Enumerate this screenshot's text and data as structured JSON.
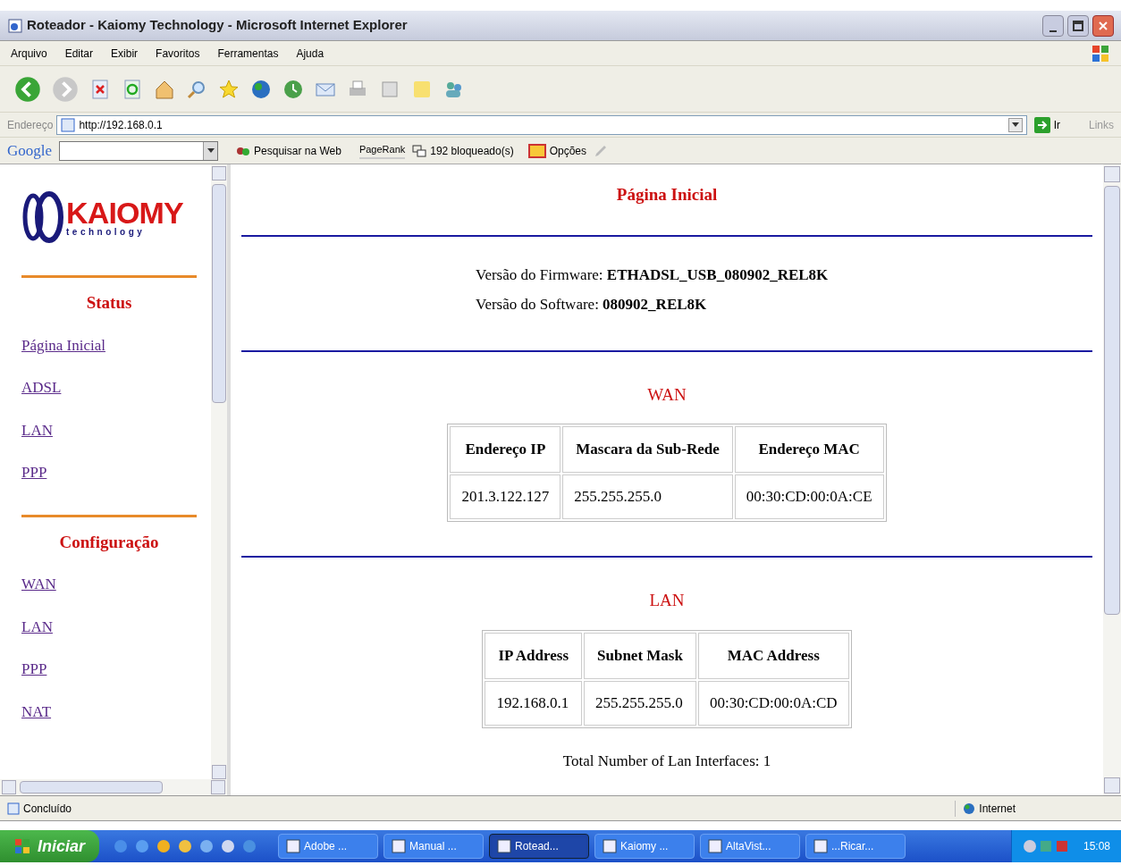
{
  "window": {
    "title": "Roteador - Kaiomy Technology - Microsoft Internet Explorer"
  },
  "menu": [
    "Arquivo",
    "Editar",
    "Exibir",
    "Favoritos",
    "Ferramentas",
    "Ajuda"
  ],
  "address": {
    "label": "Endereço",
    "url": "http://192.168.0.1",
    "go": "Ir",
    "links": "Links"
  },
  "google_bar": {
    "brand": "Google",
    "search_button": "Pesquisar na Web",
    "pagerank": "PageRank",
    "blocked": "192 bloqueado(s)",
    "options": "Opções"
  },
  "sidebar": {
    "logo": {
      "name": "KAIOMY",
      "tagline": "technology"
    },
    "sections": [
      {
        "title": "Status",
        "links": [
          "Página Inicial",
          "ADSL",
          "LAN",
          "PPP"
        ]
      },
      {
        "title": "Configuração",
        "links": [
          "WAN",
          "LAN",
          "PPP",
          "NAT"
        ]
      }
    ]
  },
  "main": {
    "title": "Página Inicial",
    "versions": [
      {
        "label": "Versão do Firmware:",
        "value": "ETHADSL_USB_080902_REL8K"
      },
      {
        "label": "Versão do Software:",
        "value": "080902_REL8K"
      }
    ],
    "sections": [
      {
        "title": "WAN",
        "columns": [
          "Endereço IP",
          "Mascara da Sub-Rede",
          "Endereço MAC"
        ],
        "rows": [
          [
            "201.3.122.127",
            "255.255.255.0",
            "00:30:CD:00:0A:CE"
          ]
        ]
      },
      {
        "title": "LAN",
        "columns": [
          "IP Address",
          "Subnet Mask",
          "MAC Address"
        ],
        "rows": [
          [
            "192.168.0.1",
            "255.255.255.0",
            "00:30:CD:00:0A:CD"
          ]
        ],
        "footer": "Total Number of Lan Interfaces: 1"
      }
    ]
  },
  "status_bar": {
    "text": "Concluído",
    "zone": "Internet"
  },
  "taskbar": {
    "start": "Iniciar",
    "tasks": [
      {
        "label": "Adobe ...",
        "selected": false
      },
      {
        "label": "Manual ...",
        "selected": false
      },
      {
        "label": "Rotead...",
        "selected": true
      },
      {
        "label": "Kaiomy ...",
        "selected": false
      },
      {
        "label": "AltaVist...",
        "selected": false
      },
      {
        "label": "...Ricar...",
        "selected": false
      }
    ],
    "clock": "15:08"
  }
}
